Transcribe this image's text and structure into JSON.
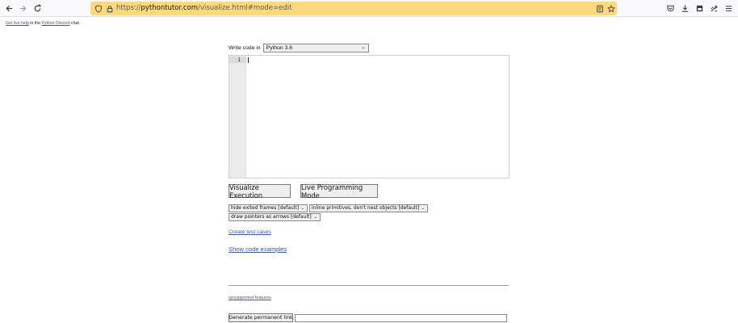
{
  "browser": {
    "url_scheme": "https://",
    "url_host": "pythontutor.com",
    "url_path": "/visualize.html#mode=edit",
    "icons": [
      "back-icon",
      "forward-icon",
      "reload-icon",
      "shield-icon",
      "lock-icon",
      "reader-view-icon",
      "bookmark-star-icon",
      "pocket-icon",
      "download-icon",
      "library-icon",
      "extensions-icon",
      "menu-icon"
    ]
  },
  "help": {
    "link1": "Get live help",
    "mid": " in the ",
    "link2": "Python Discord",
    "tail": " chat"
  },
  "editor_area": {
    "write_label": "Write code in",
    "language": "Python 3.6",
    "line_number": "1",
    "code": ""
  },
  "buttons": {
    "visualize": "Visualize Execution",
    "live": "Live Programming Mode"
  },
  "options": {
    "frames": "hide exited frames [default]",
    "primitives": "inline primitives, don't nest objects [default]",
    "pointers": "draw pointers as arrows [default]"
  },
  "links": {
    "test_cases": "Create test cases",
    "examples": "Show code examples",
    "unsupported": "unsupported features"
  },
  "permalink": {
    "button": "Generate permanent link",
    "value": ""
  },
  "colors": {
    "urlbar": "#fbd97f",
    "link": "#3d58a6"
  }
}
